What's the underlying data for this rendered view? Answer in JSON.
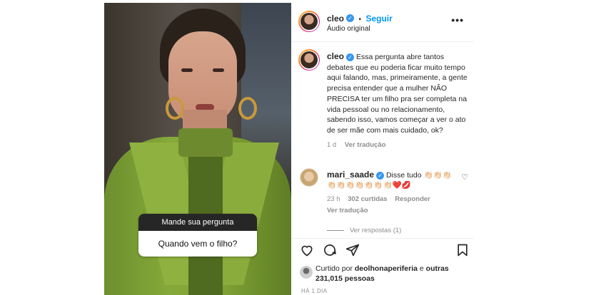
{
  "post": {
    "story_question": {
      "header": "Mande sua pergunta",
      "question": "Quando vem o filho?"
    }
  },
  "header": {
    "username": "cleo",
    "dot": "•",
    "follow_label": "Seguir",
    "audio_label": "Áudio original",
    "more_label": "•••"
  },
  "caption": {
    "username": "cleo",
    "text": "Essa pergunta abre tantos debates que eu poderia ficar muito tempo aqui falando, mas, primeiramente, a gente precisa entender que a mulher NÃO PRECISA ter um filho pra ser completa na vida pessoal ou no relacionamento, sabendo isso, vamos começar a ver o ato de ser mãe com mais cuidado, ok?",
    "time": "1 d",
    "translate_label": "Ver tradução"
  },
  "comment": {
    "username": "mari_saade",
    "text": "Disse tudo 👏🏻👏🏻👏🏻 👏🏻👏🏻👏🏻👏🏻👏🏻👏🏻👏🏻❤️💋",
    "time": "23 h",
    "likes": "302 curtidas",
    "reply_label": "Responder",
    "translate_label": "Ver tradução",
    "view_replies_label": "Ver respostas (1)"
  },
  "likes": {
    "prefix": "Curtido por",
    "user": "deolhonaperiferia",
    "conj": "e",
    "others": "outras 231,015 pessoas"
  },
  "timestamp": "HÁ 1 DIA",
  "icons": [
    "heart-icon",
    "comment-icon",
    "share-icon",
    "bookmark-icon",
    "more-icon",
    "verified-icon"
  ],
  "colors": {
    "accent": "#0095f6",
    "verified": "#3897f0",
    "muted": "#8e8e8e"
  }
}
